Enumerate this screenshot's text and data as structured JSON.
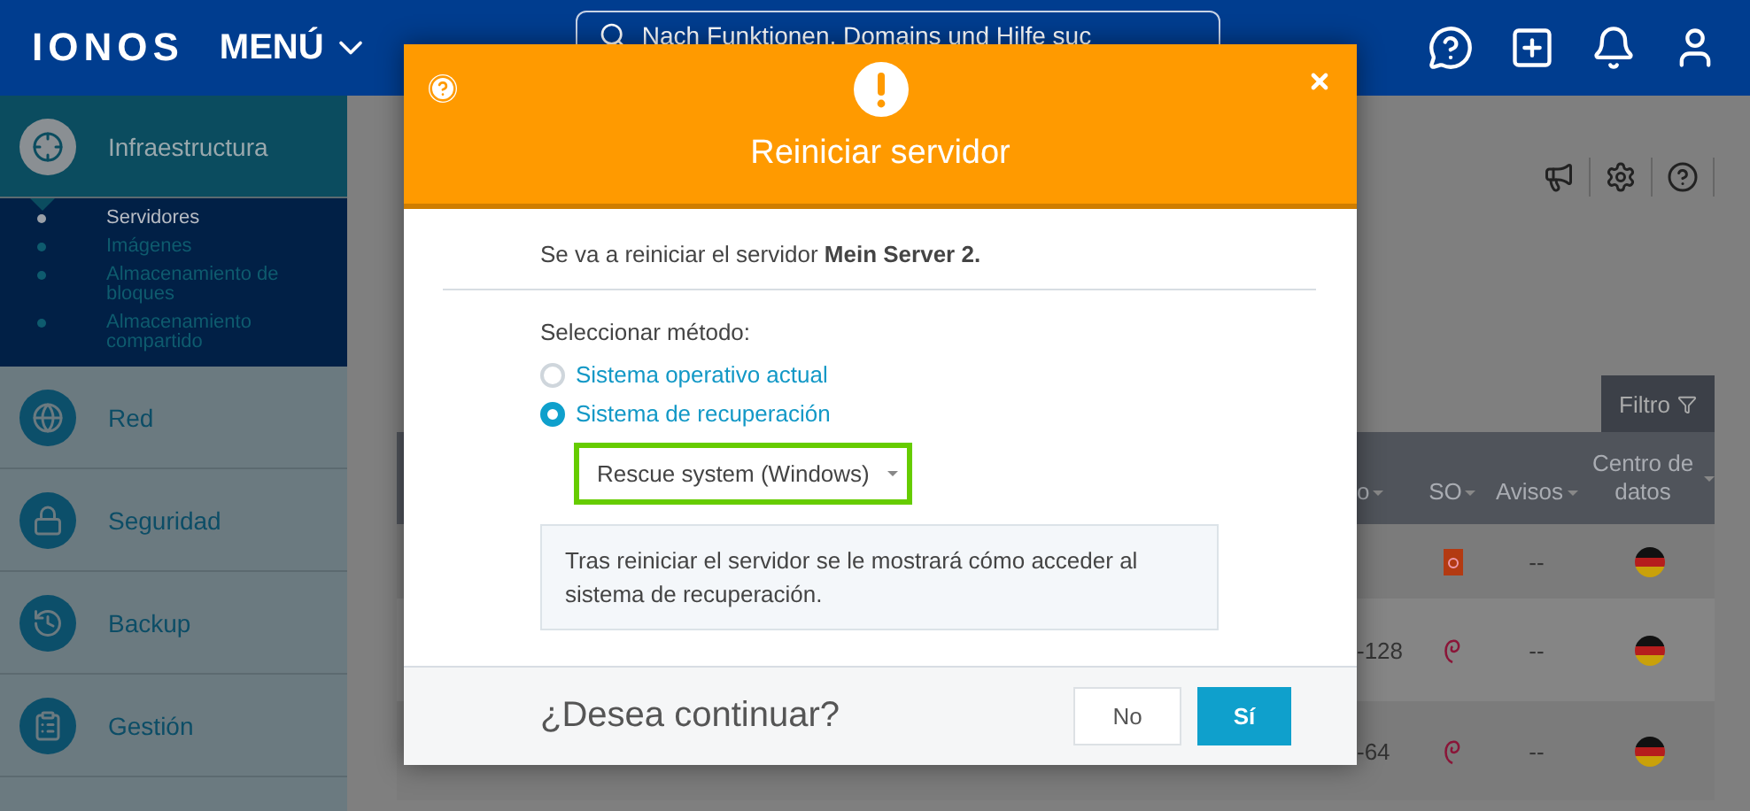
{
  "header": {
    "logo": "IONOS",
    "menu": "MENÚ",
    "search": {
      "placeholder": "Nach Funktionen, Domains und Hilfe suc"
    }
  },
  "sidebar": {
    "sections": [
      {
        "label": "Infraestructura",
        "kind": "infra",
        "selected": true,
        "children": [
          {
            "label": "Servidores",
            "selected": true
          },
          {
            "label": "Imágenes",
            "selected": false
          },
          {
            "label": "Almacenamiento de bloques",
            "selected": false
          },
          {
            "label": "Almacenamiento compartido",
            "selected": false
          }
        ]
      },
      {
        "label": "Red",
        "kind": "network",
        "selected": false
      },
      {
        "label": "Seguridad",
        "kind": "security",
        "selected": false
      },
      {
        "label": "Backup",
        "kind": "backup",
        "selected": false
      },
      {
        "label": "Gestión",
        "kind": "management",
        "selected": false
      }
    ]
  },
  "filter_button": "Filtro",
  "table": {
    "columns": [
      {
        "label": "o"
      },
      {
        "label": "SO"
      },
      {
        "label": "Avisos"
      },
      {
        "label": "Centro de datos"
      }
    ],
    "rows": [
      {
        "kind": "ubuntu",
        "alerts": "--"
      },
      {
        "column_1": "-128",
        "kind": "debian",
        "alerts": "--"
      },
      {
        "column_1": "-64",
        "kind": "debian",
        "alerts": "--"
      }
    ]
  },
  "dialog": {
    "title": "Reiniciar servidor",
    "message": "Se va a reiniciar el servidor **Mein Server 2.**",
    "method_label": "Seleccionar método:",
    "options": [
      {
        "label": "Sistema operativo actual",
        "selected": false
      },
      {
        "label": "Sistema de recuperación",
        "selected": true
      }
    ],
    "dropdown": {
      "value": "Rescue system (Windows)"
    },
    "info": "Tras reiniciar el servidor se le mostrará cómo acceder al sistema de recuperación.",
    "question": "¿Desea continuar?",
    "buttons": [
      {
        "label": "No",
        "kind": "secondary"
      },
      {
        "label": "Sí",
        "kind": "primary"
      }
    ]
  }
}
